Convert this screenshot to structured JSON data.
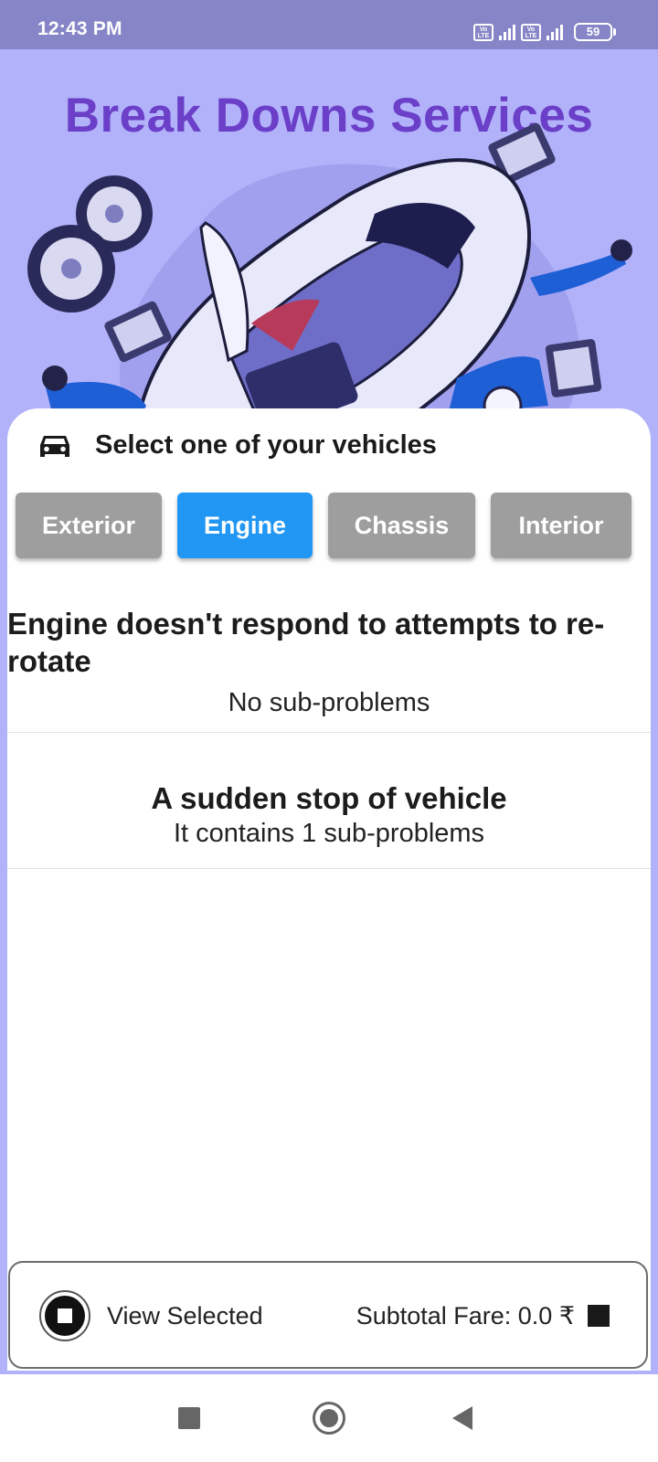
{
  "status_bar": {
    "time": "12:43 PM",
    "volte_label": "Vo LTE",
    "battery": "59"
  },
  "header": {
    "title": "Break Downs Services"
  },
  "sheet": {
    "title": "Select one of your vehicles",
    "tabs": [
      {
        "label": "Exterior",
        "active": false
      },
      {
        "label": "Engine",
        "active": true
      },
      {
        "label": "Chassis",
        "active": false
      },
      {
        "label": "Interior",
        "active": false
      }
    ],
    "problems": [
      {
        "title": "Engine doesn't respond to attempts to re-rotate",
        "subtitle": "No sub-problems"
      },
      {
        "title": "A sudden stop of vehicle",
        "subtitle": "It contains 1 sub-problems"
      }
    ]
  },
  "bottom_bar": {
    "view_label": "View Selected",
    "fare_label": "Subtotal Fare: 0.0 ₹"
  },
  "colors": {
    "hero_background": "#b2b2fa",
    "title": "#6b3fc8",
    "tab_active": "#2196f3",
    "tab_inactive": "#9e9e9e",
    "status_bar": "#8585c7"
  }
}
